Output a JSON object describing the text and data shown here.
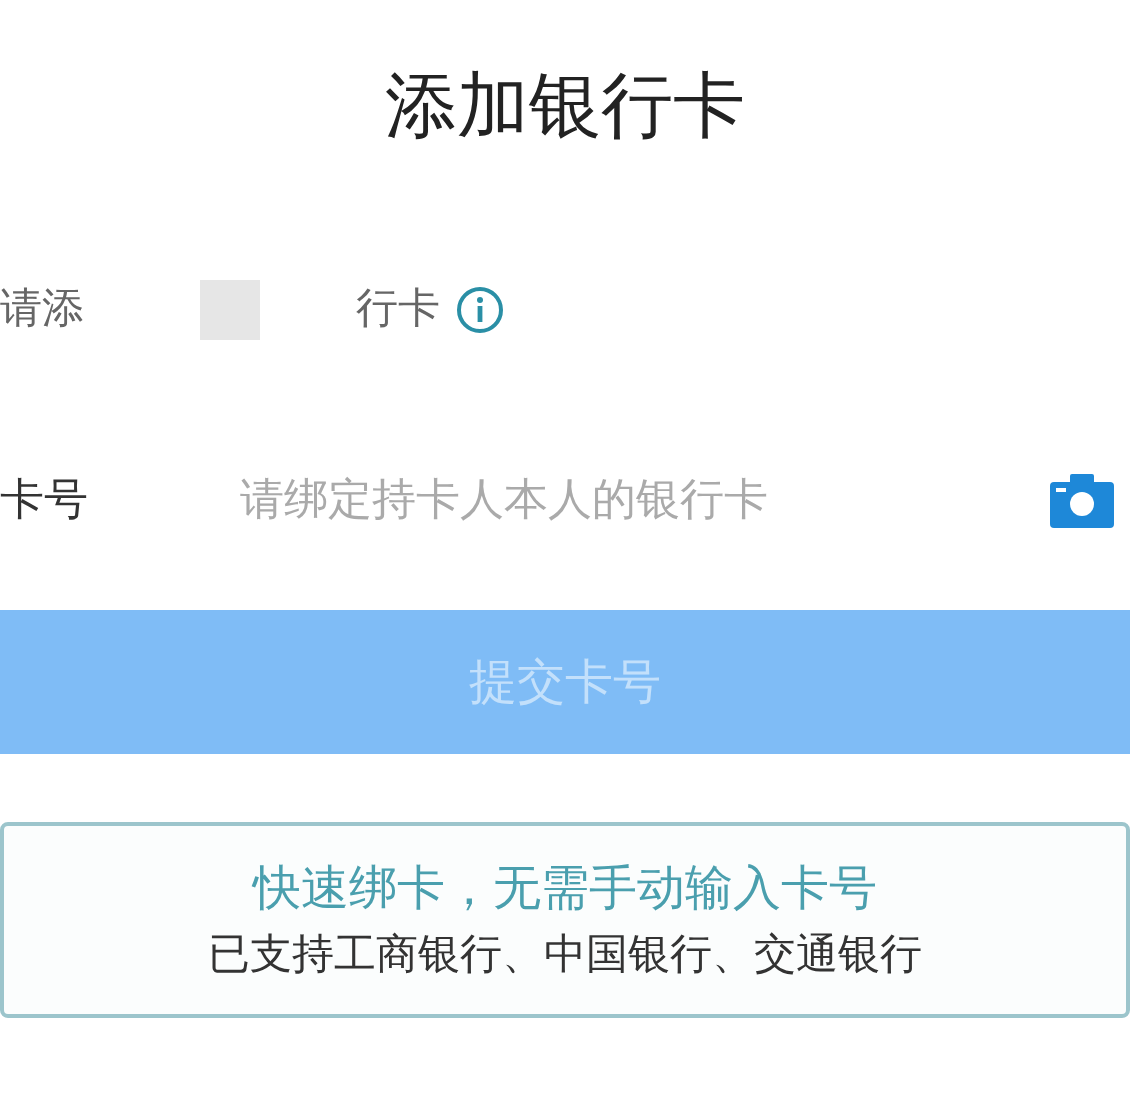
{
  "title": "添加银行卡",
  "notice": {
    "before": "请添",
    "after": "行卡"
  },
  "card_field": {
    "label": "卡号",
    "placeholder": "请绑定持卡人本人的银行卡"
  },
  "submit": {
    "label": "提交卡号",
    "disabled": true
  },
  "promo": {
    "headline": "快速绑卡，无需手动输入卡号",
    "banks": "已支持工商银行、中国银行、交通银行"
  }
}
